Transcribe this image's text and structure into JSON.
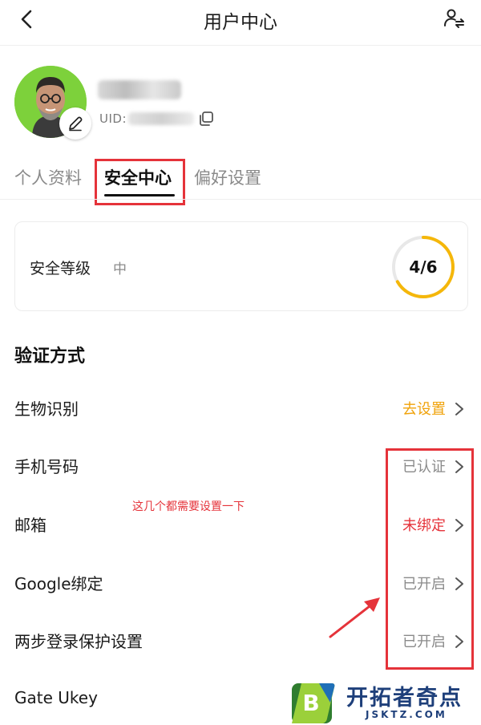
{
  "header": {
    "title": "用户中心",
    "back_icon": "chevron-left-icon",
    "right_icon": "user-switch-icon"
  },
  "profile": {
    "uid_label": "UID:",
    "copy_icon": "copy-icon",
    "edit_icon": "pencil-icon"
  },
  "tabs": [
    {
      "label": "个人资料",
      "active": false
    },
    {
      "label": "安全中心",
      "active": true
    },
    {
      "label": "偏好设置",
      "active": false
    }
  ],
  "security_level": {
    "label": "安全等级",
    "value": "中",
    "score_text": "4/6",
    "score_fraction": 0.6667,
    "ring_color": "#f5b70a",
    "ring_track_color": "#e8e8e8"
  },
  "verification": {
    "title": "验证方式",
    "items": [
      {
        "label": "生物识别",
        "status": "去设置",
        "status_color": "#f0a20a"
      },
      {
        "label": "手机号码",
        "status": "已认证",
        "status_color": "#8a8a8a"
      },
      {
        "label": "邮箱",
        "status": "未绑定",
        "status_color": "#e5333a"
      },
      {
        "label": "Google绑定",
        "status": "已开启",
        "status_color": "#8a8a8a"
      },
      {
        "label": "两步登录保护设置",
        "status": "已开启",
        "status_color": "#8a8a8a"
      },
      {
        "label": "Gate Ukey",
        "status": "",
        "status_color": "#8a8a8a"
      }
    ]
  },
  "annotation": {
    "text": "这几个都需要设置一下",
    "color": "#e5333a"
  },
  "watermark": {
    "name": "开拓者奇点",
    "url": "JSKTZ.COM",
    "logo_letter": "B"
  }
}
